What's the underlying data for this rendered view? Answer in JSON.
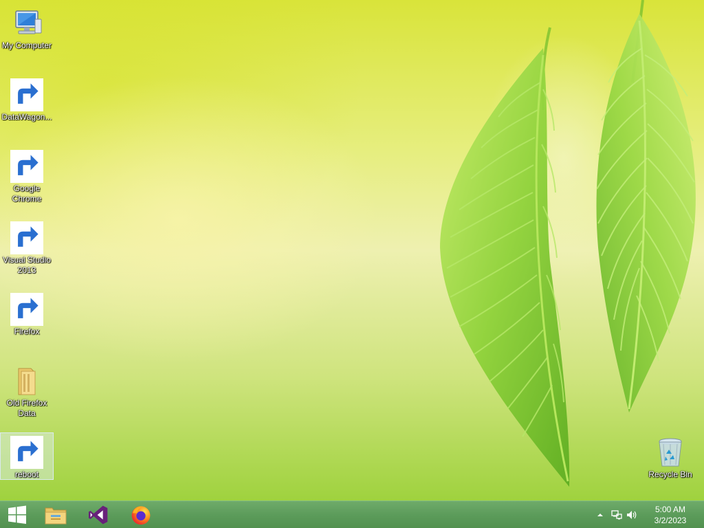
{
  "desktop": {
    "icons": [
      {
        "id": "my-computer",
        "label": "My Computer",
        "icon": "computer-icon",
        "shortcut": false
      },
      {
        "id": "datawagon",
        "label": "DataWagon...",
        "icon": "datawagon-icon",
        "shortcut": true
      },
      {
        "id": "google-chrome",
        "label": "Google Chrome",
        "icon": "blank-document-icon",
        "shortcut": true
      },
      {
        "id": "visual-studio",
        "label": "Visual Studio 2013",
        "icon": "visual-studio-icon",
        "shortcut": true
      },
      {
        "id": "firefox",
        "label": "Firefox",
        "icon": "firefox-icon",
        "shortcut": true
      },
      {
        "id": "old-firefox-data",
        "label": "Old Firefox Data",
        "icon": "folder-icon",
        "shortcut": false
      },
      {
        "id": "reboot",
        "label": "reboot",
        "icon": "settings-gear-icon",
        "shortcut": true,
        "selected": true
      },
      {
        "id": "recycle-bin",
        "label": "Recycle Bin",
        "icon": "recycle-bin-icon",
        "shortcut": false
      }
    ]
  },
  "taskbar": {
    "buttons": [
      {
        "id": "start",
        "icon": "windows-logo-icon"
      },
      {
        "id": "file-explorer",
        "icon": "file-explorer-icon"
      },
      {
        "id": "visual-studio",
        "icon": "visual-studio-icon"
      },
      {
        "id": "firefox",
        "icon": "firefox-icon"
      }
    ],
    "tray": {
      "icons": [
        "show-hidden-icons-chevron-icon",
        "network-icon",
        "volume-icon"
      ],
      "time": "5:00 AM",
      "date": "3/2/2023"
    }
  },
  "colors": {
    "taskbar": "#5c9c5b",
    "wallpaper_top": "#d9e43a",
    "wallpaper_bottom": "#9fd23e",
    "leaf": "#8fd23a"
  }
}
